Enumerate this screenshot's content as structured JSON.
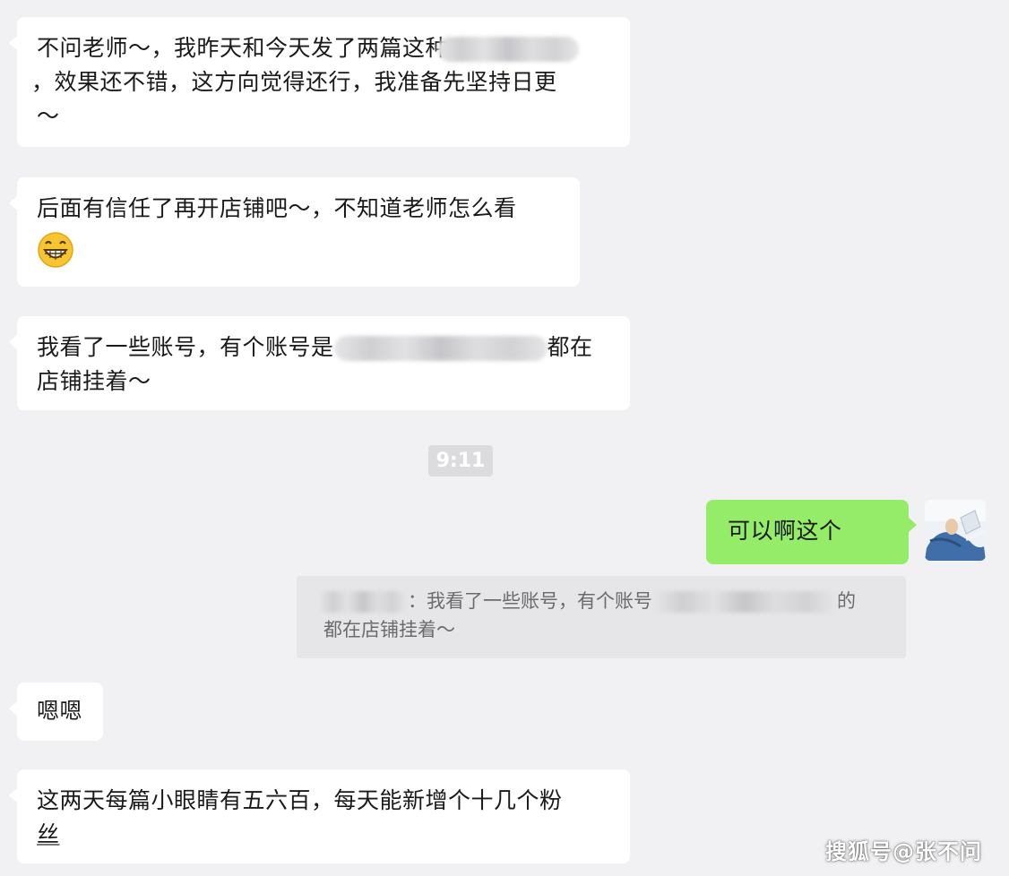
{
  "messages": {
    "m1": {
      "part1": "不问老师～，我昨天和今天发了两篇这种",
      "part2": "，效果还不错，这方向觉得还行，我准备先坚持日更",
      "part3": "～"
    },
    "m2": {
      "text": "后面有信任了再开店铺吧～，不知道老师怎么看"
    },
    "m3": {
      "part1": "我看了一些账号，有个账号是",
      "part2": "都在",
      "part3": "店铺挂着～"
    },
    "time": "9:11",
    "m4": {
      "text": "可以啊这个"
    },
    "quote": {
      "line1": "：我看了一些账号，有个账号",
      "line2_suffix": "的",
      "line3": "都在店铺挂着～"
    },
    "m5": {
      "text": "嗯嗯"
    },
    "m6": {
      "line1": "这两天每篇小眼睛有五六百，每天能新增个十几个粉",
      "line2": "丝"
    }
  },
  "watermark": "搜狐号@张不问",
  "icons": {
    "emoji": "grinning-face-icon",
    "avatar": "user-avatar"
  },
  "colors": {
    "background": "#f1f1f3",
    "bubble_left": "#ffffff",
    "bubble_right": "#95ec69",
    "quote_bg": "#e6e6e8"
  }
}
